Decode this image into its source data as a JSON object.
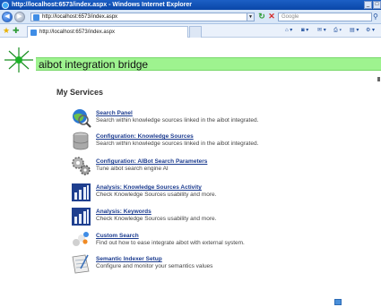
{
  "window": {
    "title": "http://localhost:6573/index.aspx - Windows Internet Explorer",
    "btn_minimize": "_",
    "btn_maximize": "□"
  },
  "address": {
    "url": "http://localhost:6573/index.aspx",
    "search_placeholder": "Google"
  },
  "tab": {
    "label": "http://localhost:6573/index.aspx"
  },
  "page": {
    "site_title": "aibot integration bridge",
    "section_title": "My Services",
    "services": [
      {
        "title": "Search Panel",
        "description": "Search within knowledge sources linked in the aibot integrated.",
        "icon": "globe-search-icon"
      },
      {
        "title": "Configuration: Knowledge Sources",
        "description": "Search within knowledge sources linked in the aibot integrated.",
        "icon": "database-icon"
      },
      {
        "title": "Configuration: AIBot Search Parameters",
        "description": "Tune aibot search engine AI",
        "icon": "gears-icon"
      },
      {
        "title": "Analysis: Knowledge Sources Activity",
        "description": "Check Knowledge Sources usability and more.",
        "icon": "bar-chart-icon"
      },
      {
        "title": "Analysis: Keywords",
        "description": "Check Knowledge Sources usability and more.",
        "icon": "bar-chart-icon"
      },
      {
        "title": "Custom Search",
        "description": "Find out how to ease integrate aibot with external system.",
        "icon": "puzzle-icon"
      },
      {
        "title": "Semantic Indexer Setup",
        "description": "Configure and monitor your semantics values",
        "icon": "notepad-icon"
      }
    ]
  },
  "colors": {
    "banner": "#9ef38f",
    "link": "#1b3b8f",
    "titlebar": "#0a47a8"
  }
}
